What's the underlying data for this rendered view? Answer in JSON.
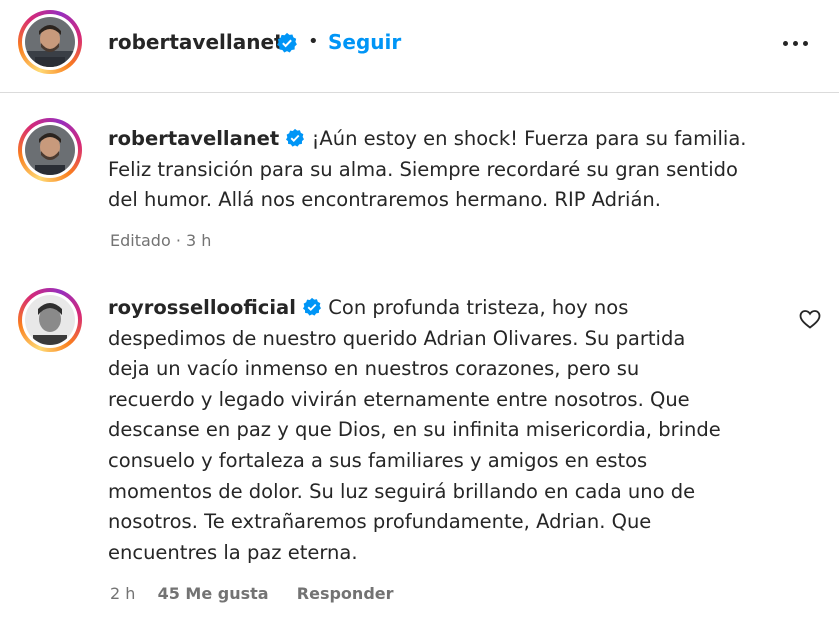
{
  "header": {
    "username": "robertavellanet",
    "separator": "•",
    "follow_label": "Seguir",
    "more_icon": "more-horizontal-icon"
  },
  "comments": [
    {
      "username": "robertavellanet",
      "verified": true,
      "lines": [
        "¡Aún estoy en shock! Fuerza para su familia.",
        "Feliz transición para su alma. Siempre recordaré su gran sentido",
        "del humor. Allá nos encontraremos hermano. RIP Adrián."
      ],
      "meta": "Editado · 3 h"
    },
    {
      "username": "royrossellooficial",
      "verified": true,
      "lines": [
        "Con profunda tristeza, hoy nos",
        "despedimos de nuestro querido Adrian Olivares. Su partida",
        "deja un vacío inmenso en nuestros corazones, pero su",
        "recuerdo y legado vivirán eternamente entre nosotros. Que",
        "descanse en paz y que Dios, en su infinita misericordia, brinde",
        "consuelo y fortaleza a sus familiares y amigos en estos",
        "momentos de dolor. Su luz seguirá brillando en cada uno de",
        "nosotros. Te extrañaremos profundamente, Adrian. Que",
        "encuentres la paz eterna."
      ],
      "time": "2 h",
      "likes": "45 Me gusta",
      "reply_label": "Responder",
      "like_icon": "heart-outline-icon"
    }
  ],
  "colors": {
    "link_blue": "#0095f6",
    "verified_blue": "#0095f6",
    "secondary_text": "#737373",
    "divider": "#dbdbdb"
  }
}
